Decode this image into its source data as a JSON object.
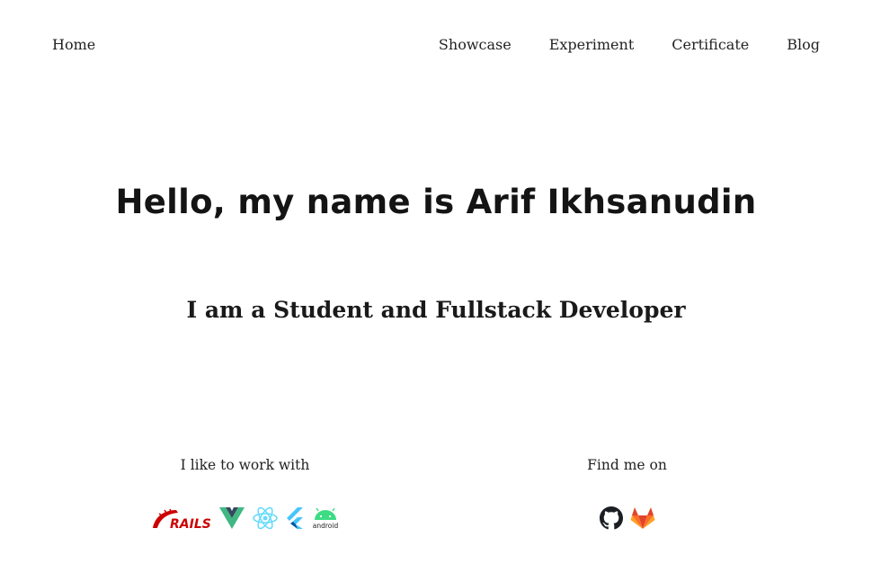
{
  "nav": {
    "home": "Home",
    "items": [
      "Showcase",
      "Experiment",
      "Certificate",
      "Blog"
    ]
  },
  "hero": {
    "title": "Hello, my name is Arif Ikhsanudin",
    "subtitle": "I am a Student and Fullstack Developer"
  },
  "tech": {
    "label": "I like to work with",
    "icons": [
      "rails-logo-icon",
      "vue-logo-icon",
      "react-logo-icon",
      "flutter-logo-icon",
      "android-logo-icon"
    ],
    "rails_text": "RAILS",
    "android_text": "android"
  },
  "social": {
    "label": "Find me on",
    "icons": [
      "github-icon",
      "gitlab-icon"
    ]
  },
  "colors": {
    "rails": "#cc0000",
    "vue_green": "#41b883",
    "vue_dark": "#35495e",
    "react": "#61dafb",
    "flutter_light": "#47c5fb",
    "flutter_dark": "#00569e",
    "android": "#3ddc84",
    "gitlab_orange": "#fc6d26",
    "gitlab_red": "#e24329",
    "gitlab_yellow": "#fca326"
  }
}
